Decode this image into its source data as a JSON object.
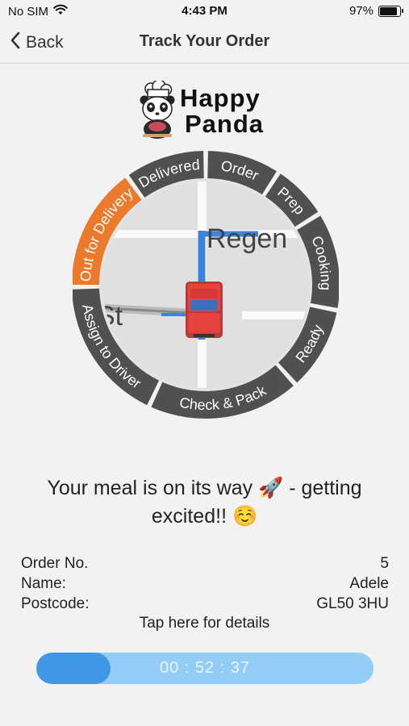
{
  "status_bar": {
    "carrier": "No SIM",
    "time": "4:43 PM",
    "battery": "97%",
    "battery_level": 0.97
  },
  "nav": {
    "back_label": "Back",
    "title": "Track Your Order"
  },
  "logo": {
    "line1": "Happy",
    "line2": "Panda"
  },
  "tracker": {
    "steps": [
      "Order",
      "Prep",
      "Cooking",
      "Ready",
      "Check & Pack",
      "Assign to Driver",
      "Out for Delivery",
      "Delivered"
    ],
    "active_step": "Out for Delivery",
    "map_labels": {
      "street_1": "Regen",
      "street_2": "St"
    },
    "colors": {
      "segment": "#505050",
      "active": "#ec7a2c",
      "text": "#ffffff"
    }
  },
  "message": {
    "text": "Your meal is on its way 🚀 - getting excited!! ☺️"
  },
  "order": {
    "number_label": "Order No.",
    "number_value": "5",
    "name_label": "Name:",
    "name_value": "Adele",
    "postcode_label": "Postcode:",
    "postcode_value": "GL50 3HU",
    "details_link": "Tap here for details"
  },
  "timer": {
    "display": "00 : 52 : 37",
    "progress": 0.22,
    "colors": {
      "track": "#93cdf7",
      "fill": "#3f97e5"
    }
  }
}
